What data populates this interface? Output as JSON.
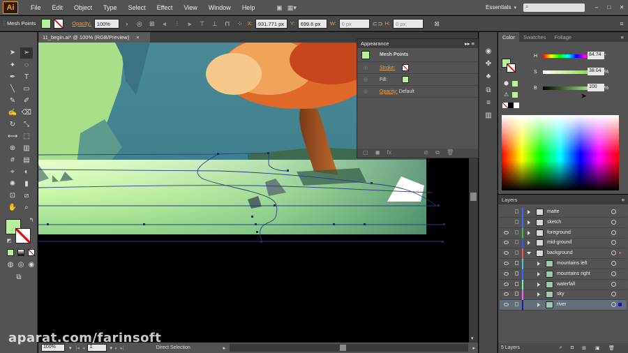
{
  "app": {
    "logo": "Ai",
    "workspace": "Essentials"
  },
  "menu": [
    "File",
    "Edit",
    "Object",
    "Type",
    "Select",
    "Effect",
    "View",
    "Window",
    "Help"
  ],
  "control": {
    "selection": "Mesh Points",
    "opacity_label": "Opacity:",
    "opacity_value": "100%",
    "x_label": "X:",
    "x_value": "931.771 px",
    "y_label": "Y:",
    "y_value": "699.6 px",
    "w_label": "W:",
    "w_value": "0 px",
    "h_label": "H:",
    "h_value": "0 px"
  },
  "document": {
    "tab": "11_begin.ai* @ 100% (RGB/Preview)",
    "close": "×"
  },
  "status": {
    "zoom": "100%",
    "page": "1",
    "tool": "Direct Selection"
  },
  "appearance": {
    "title": "Appearance",
    "object": "Mesh Points",
    "stroke_label": "Stroke:",
    "fill_label": "Fill:",
    "opacity_label": "Opacity:",
    "opacity_value": "Default",
    "fill_color": "#b8f19a"
  },
  "color": {
    "tabs": [
      "Color",
      "Swatches",
      "Foliage"
    ],
    "h_label": "H",
    "h_value": "84.74",
    "h_unit": "°",
    "s_label": "S",
    "s_value": "38.04",
    "s_unit": "%",
    "b_label": "B",
    "b_value": "100",
    "b_unit": "%"
  },
  "layers": {
    "title": "Layers",
    "footer": "5 Layers",
    "items": [
      {
        "name": "matte",
        "color": "#4a5aff",
        "eye": false,
        "indent": 0
      },
      {
        "name": "sketch",
        "color": "#3a6aff",
        "eye": false,
        "indent": 0
      },
      {
        "name": "foreground",
        "color": "#40c040",
        "eye": true,
        "indent": 0
      },
      {
        "name": "mid-ground",
        "color": "#4050ff",
        "eye": true,
        "indent": 0
      },
      {
        "name": "background",
        "color": "#ff5050",
        "eye": true,
        "indent": 0
      },
      {
        "name": "mountains left",
        "color": "#40d0d0",
        "eye": true,
        "indent": 1
      },
      {
        "name": "mountains right",
        "color": "#4060ff",
        "eye": true,
        "indent": 1
      },
      {
        "name": "waterfall",
        "color": "#60ffa0",
        "eye": true,
        "indent": 1
      },
      {
        "name": "sky",
        "color": "#ff60ff",
        "eye": true,
        "indent": 1
      },
      {
        "name": "river",
        "color": "#1a1aa0",
        "eye": true,
        "indent": 1
      }
    ]
  },
  "watermark": "aparat.com/farinsoft"
}
